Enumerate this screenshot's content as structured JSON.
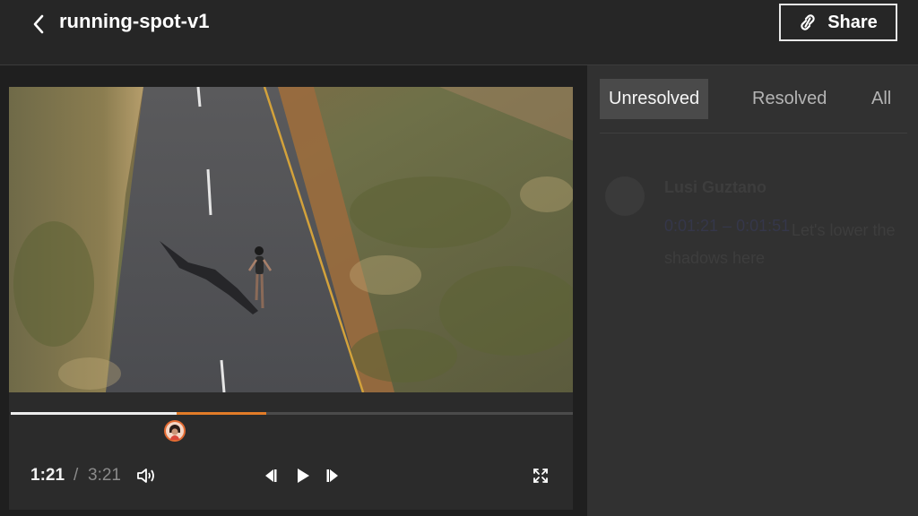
{
  "header": {
    "title": "running-spot-v1",
    "share_label": "Share"
  },
  "player": {
    "current_time": "1:21",
    "separator": "/",
    "total_time": "3:21",
    "played_fraction": 0.295,
    "buffered_fraction": 0.455
  },
  "comments_panel": {
    "tabs": [
      {
        "label": "Unresolved",
        "active": true
      },
      {
        "label": "Resolved",
        "active": false
      },
      {
        "label": "All",
        "active": false
      }
    ],
    "comments": [
      {
        "author": "Lusi Guztano",
        "timestamp_link": "0:01:21 – 0:01:51",
        "text": "Let's lower the shadows here"
      }
    ]
  },
  "icons": {
    "back": "chevron-left-icon",
    "share": "link-icon",
    "volume": "volume-icon",
    "previous_frame": "previous-frame-icon",
    "play": "play-icon",
    "next_frame": "next-frame-icon",
    "fullscreen": "fullscreen-icon"
  },
  "colors": {
    "accent": "#e27c28",
    "marker": "#e36b33",
    "background": "#262626",
    "panel": "#313131"
  }
}
